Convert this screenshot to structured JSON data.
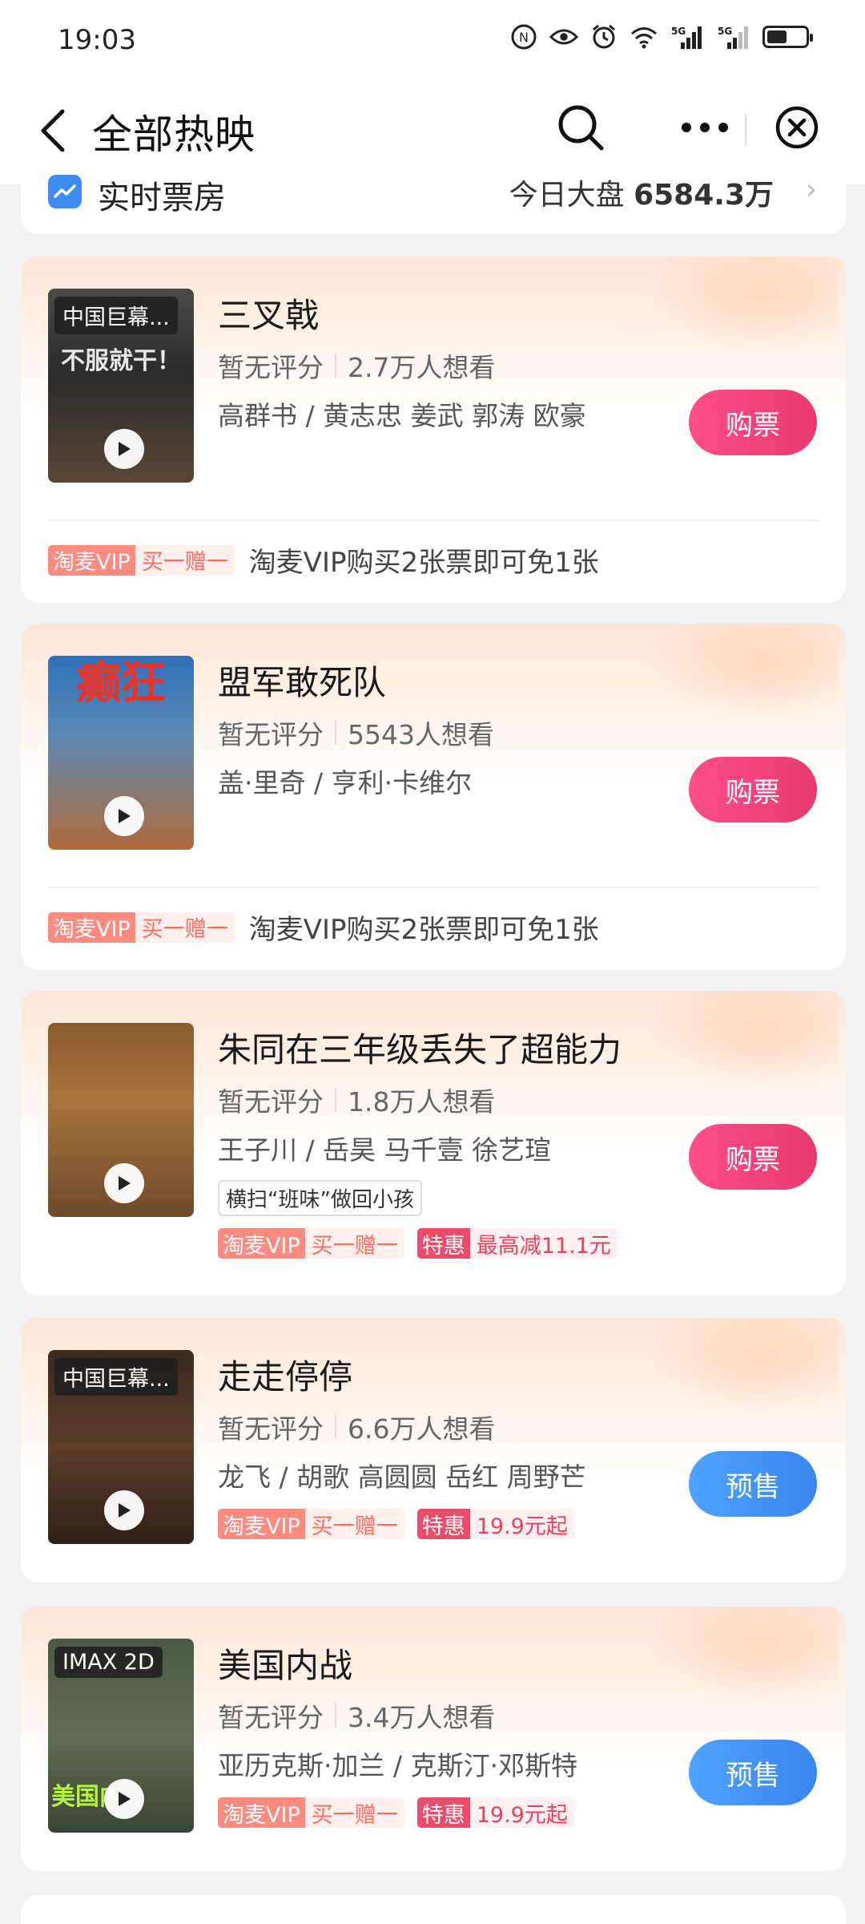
{
  "status_bar": {
    "time": "19:03",
    "network_labels": [
      "5G",
      "5G"
    ]
  },
  "nav": {
    "title": "全部热映",
    "back_icon": "chevron-left-icon",
    "search_icon": "search-icon",
    "more_icon": "more-icon",
    "close_icon": "close-icon"
  },
  "box_office": {
    "label": "实时票房",
    "total_prefix": "今日大盘",
    "total_value": "6584.3万",
    "chevron": "›"
  },
  "colors": {
    "buy_pink": "#e83a6e",
    "presale_blue": "#3a86f0",
    "vip_tag": "#ff8a80",
    "deal_tag": "#ee4b6a"
  },
  "promo_labels": {
    "vip": "淘麦VIP",
    "bogo": "买一赠一",
    "deal": "特惠"
  },
  "movies": [
    {
      "title": "三叉戟",
      "score": "暂无评分",
      "want": "2.7万人想看",
      "cast": "高群书 / 黄志忠 姜武 郭涛 欧豪",
      "button": "购票",
      "badge": "中国巨幕...",
      "poster_text": "不服就干！",
      "promo_text": "淘麦VIP购买2张票即可免1张"
    },
    {
      "title": "盟军敢死队",
      "score": "暂无评分",
      "want": "5543人想看",
      "cast": "盖·里奇 / 亨利·卡维尔",
      "button": "购票",
      "poster_text": "癫狂",
      "promo_text": "淘麦VIP购买2张票即可免1张"
    },
    {
      "title": "朱同在三年级丢失了超能力",
      "score": "暂无评分",
      "want": "1.8万人想看",
      "cast": "王子川 / 岳昊 马千壹 徐艺瑄",
      "button": "购票",
      "feature": "横扫“班味”做回小孩",
      "deal_text": "最高减11.1元"
    },
    {
      "title": "走走停停",
      "score": "暂无评分",
      "want": "6.6万人想看",
      "cast": "龙飞 / 胡歌 高圆圆 岳红 周野芒",
      "button": "预售",
      "badge": "中国巨幕...",
      "deal_text": "19.9元起"
    },
    {
      "title": "美国内战",
      "score": "暂无评分",
      "want": "3.4万人想看",
      "cast": "亚历克斯·加兰 / 克斯汀·邓斯特",
      "button": "预售",
      "badge": "IMAX 2D",
      "poster_text": "美国内",
      "deal_text": "19.9元起"
    }
  ]
}
